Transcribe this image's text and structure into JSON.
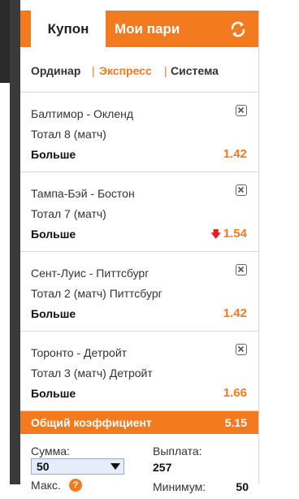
{
  "header": {
    "tab_coupon": "Купон",
    "tab_my_bets": "Мои пари"
  },
  "bet_types": {
    "single": "Ординар",
    "express": "Экспресс",
    "system": "Система",
    "selected": "Экспресс"
  },
  "bets": [
    {
      "match": "Балтимор - Окленд",
      "market": "Тотал 8 (матч)",
      "outcome": "Больше",
      "odds": "1.42",
      "odds_changed": false
    },
    {
      "match": "Тампа-Бэй - Бостон",
      "market": "Тотал 7 (матч)",
      "outcome": "Больше",
      "odds": "1.54",
      "odds_changed": true
    },
    {
      "match": "Сент-Луис - Питтсбург",
      "market": "Тотал 2 (матч) Питтсбург",
      "outcome": "Больше",
      "odds": "1.42",
      "odds_changed": false
    },
    {
      "match": "Торонто - Детройт",
      "market": "Тотал 3 (матч) Детройт",
      "outcome": "Больше",
      "odds": "1.66",
      "odds_changed": false
    }
  ],
  "total": {
    "label": "Общий коэффициент",
    "value": "5.15"
  },
  "footer": {
    "sum_label": "Сумма:",
    "sum_value": "50",
    "max_label": "Макс.",
    "help_glyph": "?",
    "payout_label": "Выплата:",
    "payout_value": "257",
    "min_label": "Минимум:",
    "min_value": "50"
  },
  "colors": {
    "accent": "#f47a20",
    "odds_down": "#e02020"
  }
}
